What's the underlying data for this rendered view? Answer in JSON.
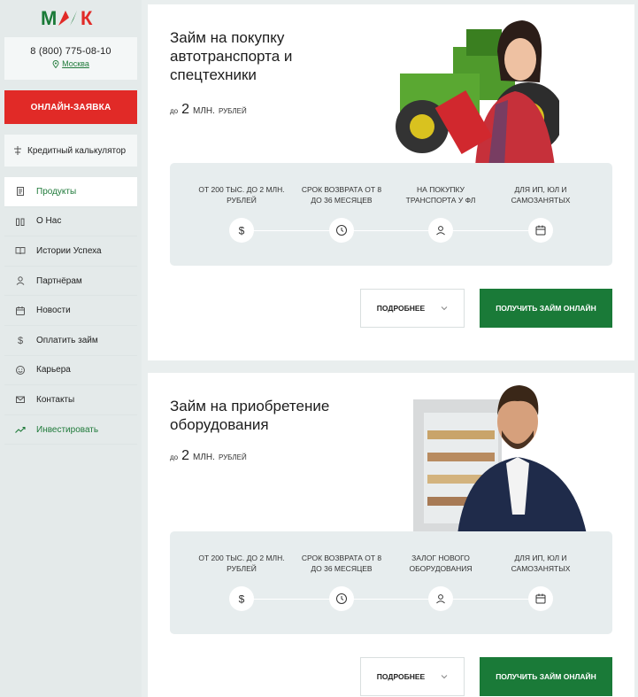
{
  "brand": {
    "logo_text": "МФК",
    "red": "#e12a27",
    "green": "#1a7a38"
  },
  "contact": {
    "phone": "8 (800) 775-08-10",
    "city": "Москва"
  },
  "sidebar": {
    "apply_label": "ОНЛАЙН-ЗАЯВКА",
    "calc_label": "Кредитный калькулятор",
    "items": [
      {
        "label": "Продукты",
        "icon": "document-icon",
        "active": true
      },
      {
        "label": "О Нас",
        "icon": "building-icon"
      },
      {
        "label": "Истории Успеха",
        "icon": "book-icon"
      },
      {
        "label": "Партнёрам",
        "icon": "user-icon"
      },
      {
        "label": "Новости",
        "icon": "calendar-icon"
      },
      {
        "label": "Оплатить займ",
        "icon": "dollar-icon"
      },
      {
        "label": "Карьера",
        "icon": "smile-icon"
      },
      {
        "label": "Контакты",
        "icon": "mail-icon"
      },
      {
        "label": "Инвестировать",
        "icon": "trend-icon"
      }
    ]
  },
  "products": [
    {
      "title": "Займ на покупку автотранспорта и спецтехники",
      "amount_prefix": "до",
      "amount_value": "2",
      "amount_unit": "МЛН.",
      "amount_suffix": "РУБЛЕЙ",
      "features": [
        {
          "text": "от 200 тыс. до 2 млн. рублей",
          "icon": "dollar-icon"
        },
        {
          "text": "срок возврата от 8 до 36 месяцев",
          "icon": "clock-icon"
        },
        {
          "text": "на покупку транспорта у ФЛ",
          "icon": "user-icon"
        },
        {
          "text": "для ИП, ЮЛ и самозанятых",
          "icon": "calendar-icon"
        }
      ],
      "more_label": "ПОДРОБНЕЕ",
      "get_label": "ПОЛУЧИТЬ ЗАЙМ ОНЛАЙН"
    },
    {
      "title": "Займ на приобретение оборудования",
      "amount_prefix": "до",
      "amount_value": "2",
      "amount_unit": "МЛН.",
      "amount_suffix": "РУБЛЕЙ",
      "features": [
        {
          "text": "от 200 тыс. до 2 млн. рублей",
          "icon": "dollar-icon"
        },
        {
          "text": "срок возврата от 8 до 36 месяцев",
          "icon": "clock-icon"
        },
        {
          "text": "залог нового оборудования",
          "icon": "user-icon"
        },
        {
          "text": "для ИП, ЮЛ и самозанятых",
          "icon": "calendar-icon"
        }
      ],
      "more_label": "ПОДРОБНЕЕ",
      "get_label": "ПОЛУЧИТЬ ЗАЙМ ОНЛАЙН"
    }
  ]
}
